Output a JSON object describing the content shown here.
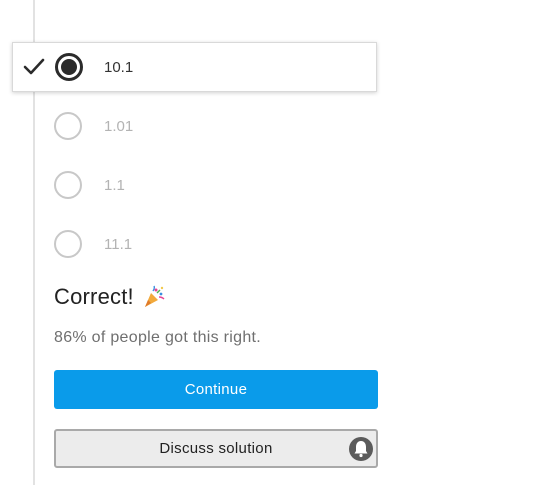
{
  "question": {
    "options": [
      {
        "label": "10.1",
        "selected": true
      },
      {
        "label": "1.01",
        "selected": false
      },
      {
        "label": "1.1",
        "selected": false
      },
      {
        "label": "11.1",
        "selected": false
      }
    ]
  },
  "result": {
    "title": "Correct!",
    "icon": "party-popper-icon",
    "stats": "86% of people got this right."
  },
  "actions": {
    "continue_label": "Continue",
    "discuss_label": "Discuss solution",
    "discuss_icon": "bell-icon"
  },
  "colors": {
    "primary": "#0a9bea",
    "selected_radio": "#2b2b2b",
    "unselected_radio": "#c8c8c8"
  }
}
